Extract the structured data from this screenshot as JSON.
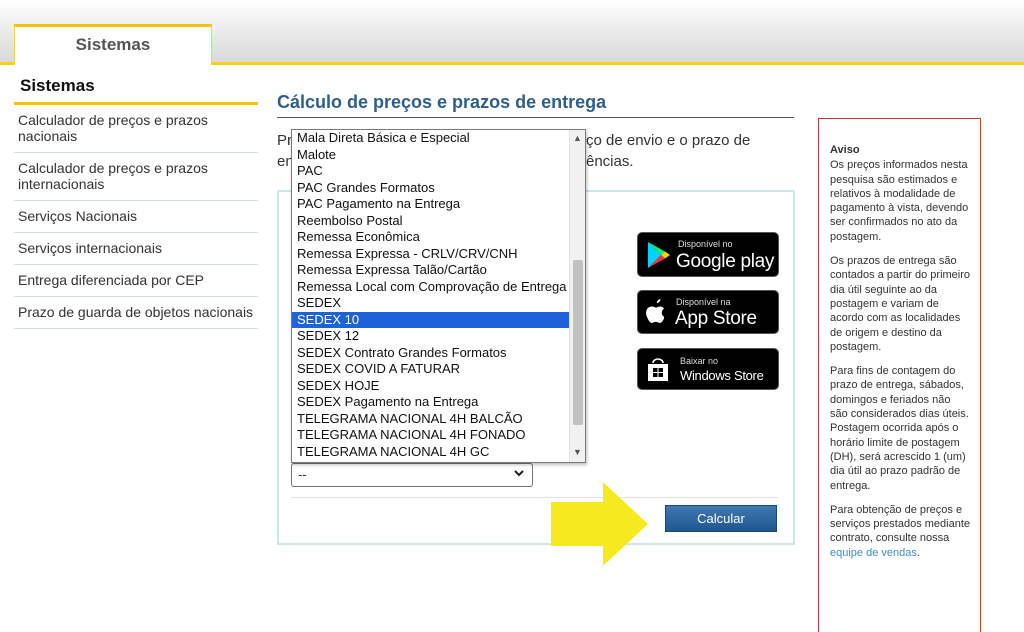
{
  "header": {
    "tab_label": "Sistemas"
  },
  "sidebar": {
    "title": "Sistemas",
    "items": [
      {
        "label": "Calculador de preços e prazos nacionais"
      },
      {
        "label": "Calculador de preços e prazos internacionais"
      },
      {
        "label": "Serviços Nacionais"
      },
      {
        "label": "Serviços internacionais"
      },
      {
        "label": "Entrega diferenciada por CEP"
      },
      {
        "label": "Prazo de guarda de objetos nacionais"
      }
    ]
  },
  "main": {
    "title": "Cálculo de preços e prazos de entrega",
    "intro_line1_start": "Pr",
    "intro_line1_end": "ço de envio e o prazo de",
    "intro_line2_start": "en",
    "intro_line2_end": "ências."
  },
  "dropdown": {
    "options": [
      "Mala Direta Básica e Especial",
      "Malote",
      "PAC",
      "PAC Grandes Formatos",
      "PAC Pagamento na Entrega",
      "Reembolso Postal",
      "Remessa Econômica",
      "Remessa Expressa - CRLV/CRV/CNH",
      "Remessa Expressa Talão/Cartão",
      "Remessa Local com Comprovação de Entrega",
      "SEDEX",
      "SEDEX 10",
      "SEDEX 12",
      "SEDEX Contrato Grandes Formatos",
      "SEDEX COVID A FATURAR",
      "SEDEX HOJE",
      "SEDEX Pagamento na Entrega",
      "TELEGRAMA NACIONAL 4H BALCÃO",
      "TELEGRAMA NACIONAL 4H FONADO",
      "TELEGRAMA NACIONAL 4H GC"
    ],
    "selected_index": 11
  },
  "form": {
    "second_select_value": "--",
    "calc_button_label": "Calcular"
  },
  "badges": {
    "google_small": "Disponível no",
    "google_big": "Google play",
    "apple_small": "Disponível na",
    "apple_big": "App Store",
    "windows_small": "Baixar no",
    "windows_big": "Windows Store"
  },
  "notice": {
    "title": "Aviso",
    "p1": "Os preços informados nesta pesquisa são estimados e relativos à modalidade de pagamento à vista, devendo ser confirmados no ato da postagem.",
    "p2": "Os prazos de entrega são contados a partir do primeiro dia útil seguinte ao da postagem e variam de acordo com as localidades de origem e destino da postagem.",
    "p3": "Para fins de contagem do prazo de entrega, sábados, domingos e feriados não são considerados dias úteis. Postagem ocorrida após o horário limite de postagem (DH), será acrescido 1 (um) dia útil ao prazo padrão de entrega.",
    "p4_text": "Para obtenção de preços e serviços prestados mediante contrato, consulte nossa ",
    "p4_link": "equipe de vendas",
    "p4_end": "."
  },
  "colors": {
    "accent_yellow": "#f2c500",
    "title_blue": "#2f5e8b",
    "button_blue": "#1f568e",
    "selected_blue": "#1d62d6",
    "notice_border": "#cc3333",
    "arrow_yellow": "#f5ea1e"
  }
}
